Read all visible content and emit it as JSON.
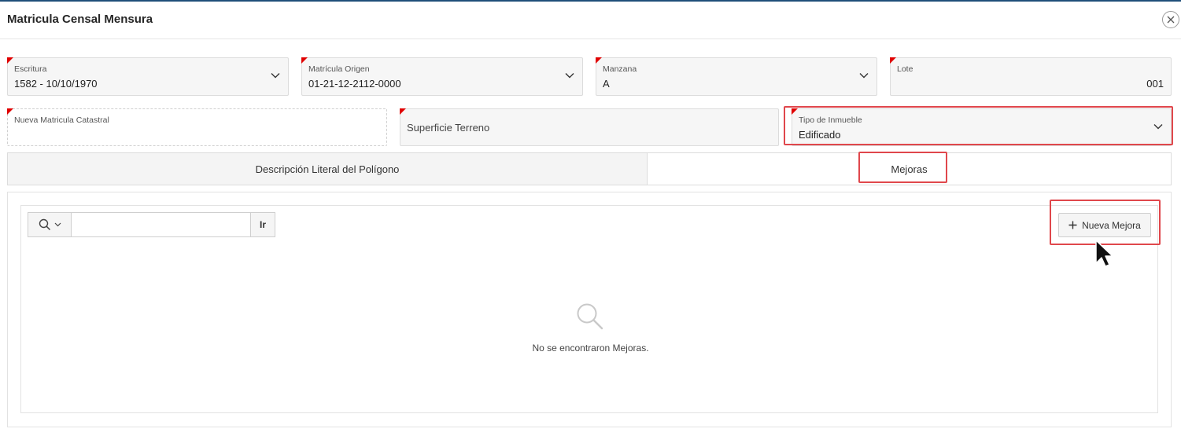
{
  "dialog": {
    "title": "Matricula Censal Mensura",
    "close_icon": "close-icon"
  },
  "form": {
    "escritura": {
      "label": "Escritura",
      "value": "1582 - 10/10/1970",
      "required": true
    },
    "matricula_origen": {
      "label": "Matrícula Origen",
      "value": "01-21-12-2112-0000",
      "required": true
    },
    "manzana": {
      "label": "Manzana",
      "value": "A",
      "required": true
    },
    "lote": {
      "label": "Lote",
      "value": "001",
      "required": true
    },
    "nueva_matricula": {
      "label": "Nueva Matricula Catastral",
      "value": "",
      "required": true
    },
    "superficie_terreno": {
      "label": "Superficie Terreno",
      "value": "",
      "required": true
    },
    "tipo_inmueble": {
      "label": "Tipo de Inmueble",
      "value": "Edificado",
      "required": true
    }
  },
  "tabs": [
    {
      "label": "Descripción Literal del Polígono",
      "active": false
    },
    {
      "label": "Mejoras",
      "active": true
    }
  ],
  "report": {
    "search_placeholder": "",
    "go_label": "Ir",
    "new_button_label": "Nueva Mejora",
    "empty_message": "No se encontraron Mejoras."
  },
  "colors": {
    "required_marker": "#e00000",
    "highlight": "#e0474c"
  }
}
